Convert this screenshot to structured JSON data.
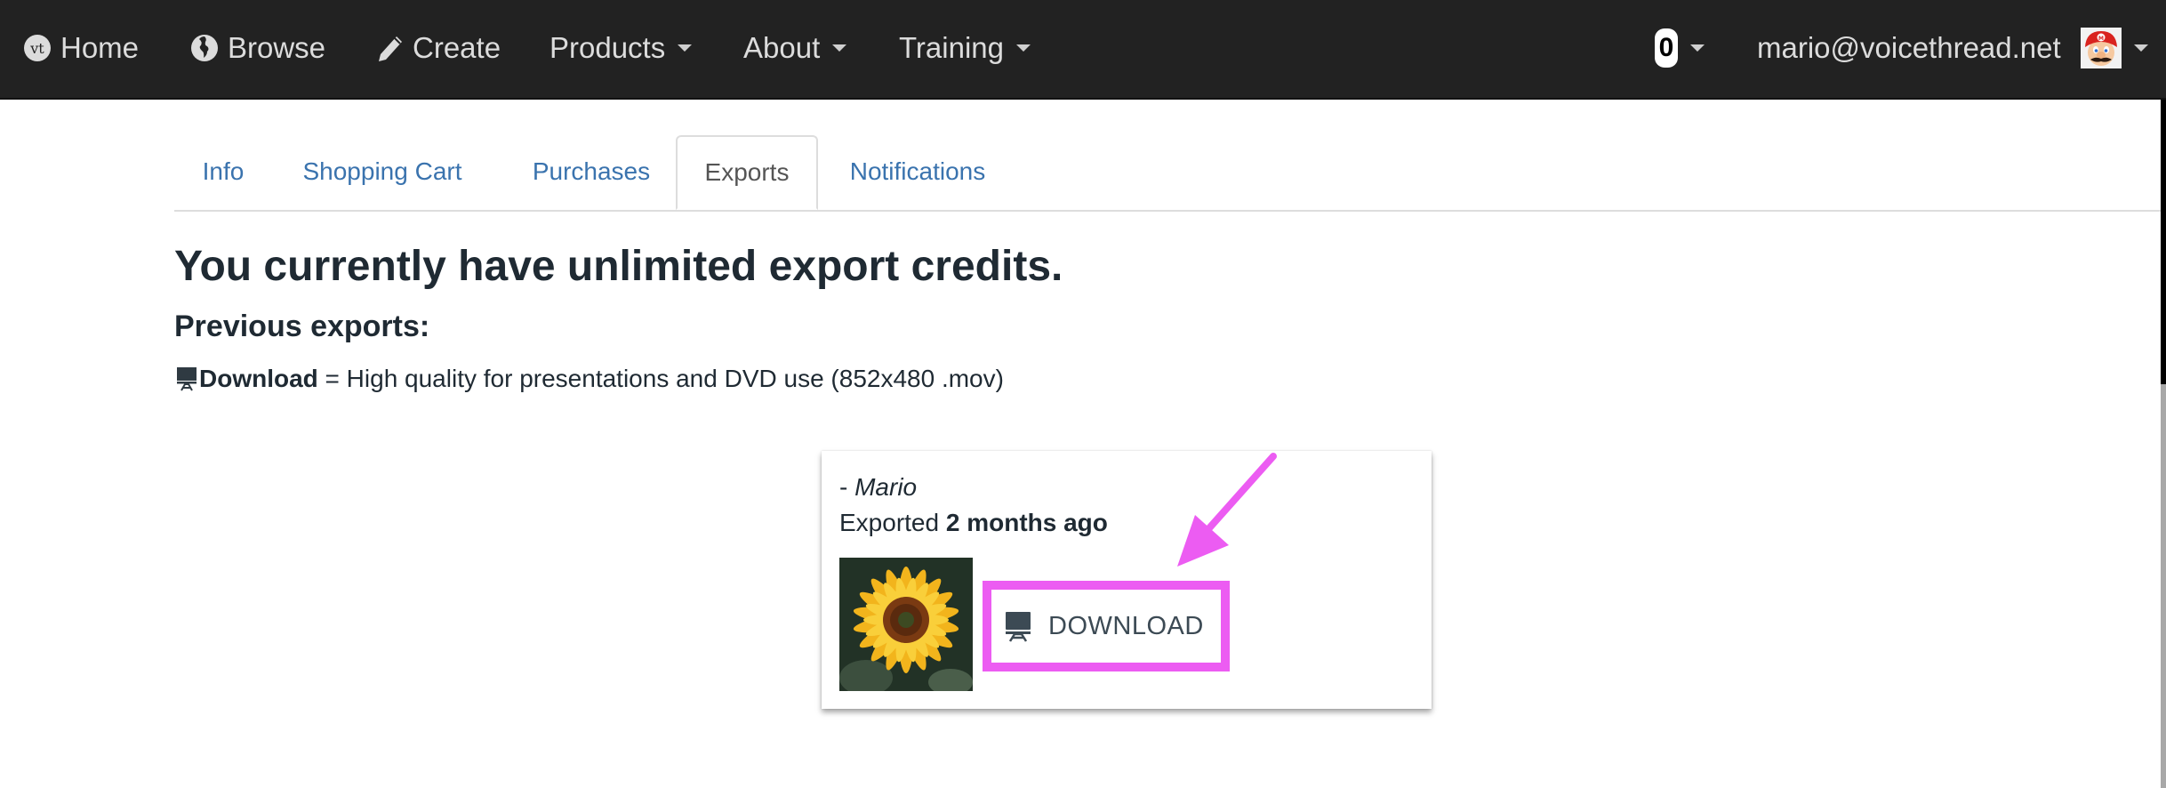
{
  "navbar": {
    "items": [
      {
        "label": "Home",
        "icon": "vt-logo-icon"
      },
      {
        "label": "Browse",
        "icon": "globe-icon"
      },
      {
        "label": "Create",
        "icon": "pencil-icon"
      },
      {
        "label": "Products",
        "dropdown": true
      },
      {
        "label": "About",
        "dropdown": true
      },
      {
        "label": "Training",
        "dropdown": true
      }
    ],
    "notification_count": "0",
    "user_email": "mario@voicethread.net",
    "avatar_icon": "user-avatar-mario"
  },
  "tabs": [
    {
      "label": "Info",
      "active": false
    },
    {
      "label": "Shopping Cart",
      "active": false
    },
    {
      "label": "Purchases",
      "active": false
    },
    {
      "label": "Exports",
      "active": true
    },
    {
      "label": "Notifications",
      "active": false
    }
  ],
  "main": {
    "credits_heading": "You currently have unlimited export credits.",
    "previous_heading": "Previous exports:",
    "legend": {
      "icon": "presentation-icon",
      "label": "Download",
      "description": " = High quality for presentations and DVD use (852x480 .mov)"
    }
  },
  "export_card": {
    "author_prefix": "- ",
    "author": "Mario",
    "exported_prefix": "Exported ",
    "exported_time": "2 months ago",
    "thumbnail": "sunflower-thumbnail",
    "download_label": "DOWNLOAD"
  },
  "annotation": {
    "highlight_color": "#ec5cf2"
  },
  "colors": {
    "navbar_bg": "#222222",
    "link": "#3a73ae",
    "text": "#1f2a33"
  }
}
